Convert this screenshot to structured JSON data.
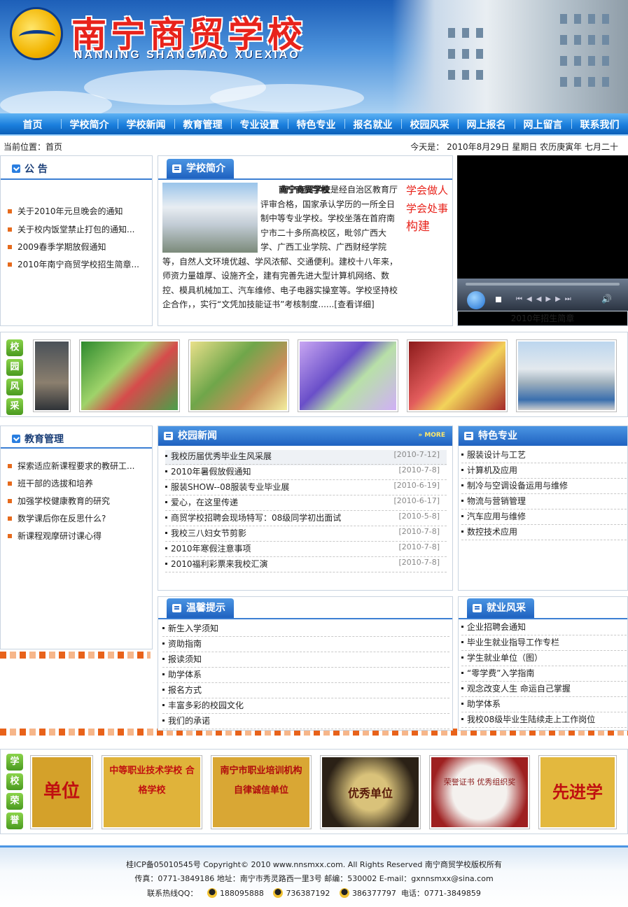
{
  "header": {
    "title_cn": "南宁商贸学校",
    "title_en": "NANNING SHANGMAO XUEXIAO"
  },
  "nav": {
    "items": [
      "首页",
      "学校简介",
      "学校新闻",
      "教育管理",
      "专业设置",
      "特色专业",
      "报名就业",
      "校园风采",
      "网上报名",
      "网上留言",
      "联系我们"
    ]
  },
  "location": {
    "current": "当前位置：首页",
    "date": "今天是： 2010年8月29日 星期日 农历庚寅年 七月二十"
  },
  "notice": {
    "title": "公 告",
    "items": [
      "关于2010年元旦晚会的通知",
      "关于校内饭堂禁止打包的通知...",
      "2009春季学期放假通知",
      "2010年南宁商贸学校招生简章..."
    ]
  },
  "intro": {
    "title": "学校简介",
    "name": "南宁商贸学校",
    "text": "是经自治区教育厅评审合格，国家承认学历的一所全日制中等专业学校。学校坐落在首府南宁市二十多所高校区，毗邻广西大学、广西工业学院、广西财经学院等，自然人文环境优越、学风浓郁、交通便利。建校十八年来，师资力量雄厚、设施齐全，建有完善先进大型计算机网络、数控、模具机械加工、汽车维修、电子电器实操室等。学校坚持校企合作，，实行“文凭加技能证书”考核制度......",
    "more": "[查看详细]",
    "slogan": [
      "学会做人",
      "学会处事",
      "构建"
    ]
  },
  "video": {
    "caption": "2010年招生简章"
  },
  "campus_strip": {
    "badges": [
      "校",
      "园",
      "风",
      "采"
    ]
  },
  "edu": {
    "title": "教育管理",
    "items": [
      "探索适应新课程要求的教研工...",
      "班干部的选拔和培养",
      "加强学校健康教育的研究",
      "数学课后你在反思什么?",
      "新课程观摩研讨课心得"
    ]
  },
  "news": {
    "title": "校园新闻",
    "more": "MORE",
    "items": [
      {
        "title": "我校历届优秀毕业生风采展",
        "date": "[2010-7-12]"
      },
      {
        "title": "2010年暑假放假通知",
        "date": "[2010-7-8]"
      },
      {
        "title": "服装SHOW--08服装专业毕业展",
        "date": "[2010-6-19]"
      },
      {
        "title": "爱心，在这里传递",
        "date": "[2010-6-17]"
      },
      {
        "title": "商贸学校招聘会现场特写：08级同学初出面试",
        "date": "[2010-5-8]"
      },
      {
        "title": "我校三八妇女节剪影",
        "date": "[2010-7-8]"
      },
      {
        "title": "2010年寒假注意事项",
        "date": "[2010-7-8]"
      },
      {
        "title": "2010福利彩票来我校汇演",
        "date": "[2010-7-8]"
      }
    ]
  },
  "special": {
    "title": "特色专业",
    "items": [
      "服装设计与工艺",
      "计算机及应用",
      "制冷与空调设备运用与维修",
      "物流与营销管理",
      "汽车应用与维修",
      "数控技术应用"
    ]
  },
  "tips": {
    "title": "温馨提示",
    "items": [
      "新生入学须知",
      "资助指南",
      "报读须知",
      "助学体系",
      "报名方式",
      "丰富多彩的校园文化",
      "我们的承诺"
    ]
  },
  "jobs": {
    "title": "就业风采",
    "items": [
      "企业招聘会通知",
      "毕业生就业指导工作专栏",
      "学生就业单位（图）",
      "“零学费”入学指南",
      "观念改变人生 命运自己掌握",
      "助学体系",
      "我校08级毕业生陆续走上工作岗位"
    ]
  },
  "honor_strip": {
    "badges": [
      "学",
      "校",
      "荣",
      "誉"
    ],
    "plaques": [
      "单位",
      "中等职业技术学校 合格学校",
      "南宁市职业培训机构 自律诚信单位",
      "优秀单位",
      "荣誉证书 优秀组织奖",
      "先进学"
    ]
  },
  "footer": {
    "line1": "桂ICP备05010545号 Copyright© 2010 www.nnsmxx.com. All Rights Reserved 南宁商贸学校版权所有",
    "line2": "传真：0771-3849186 地址：南宁市秀灵路西一里3号  邮编：530002 E-mail：gxnnsmxx@sina.com",
    "qq_label": "联系热线QQ：",
    "qq": [
      "188095888",
      "736387192",
      "386377797"
    ],
    "phone": "电话：0771-3849859"
  }
}
